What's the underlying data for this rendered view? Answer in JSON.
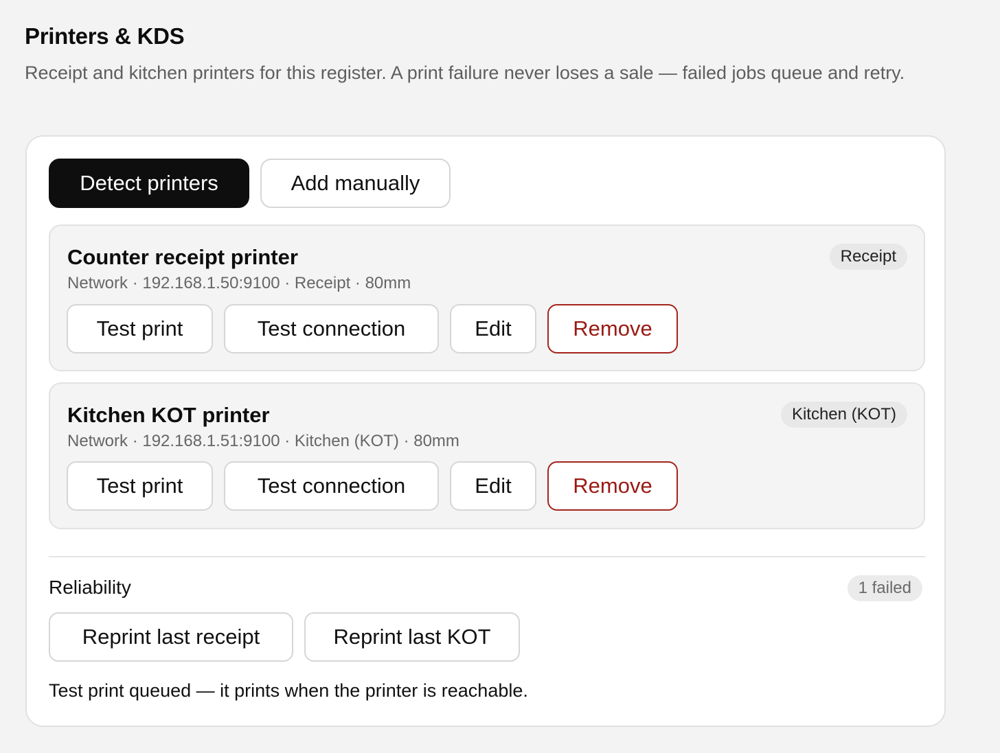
{
  "header": {
    "title": "Printers & KDS",
    "description": "Receipt and kitchen printers for this register. A print failure never loses a sale — failed jobs queue and retry."
  },
  "toolbar": {
    "detect_label": "Detect printers",
    "add_label": "Add manually"
  },
  "printers": [
    {
      "name": "Counter receipt printer",
      "meta": "Network · 192.168.1.50:9100 · Receipt · 80mm",
      "badge": "Receipt",
      "actions": {
        "test_print": "Test print",
        "test_connection": "Test connection",
        "edit": "Edit",
        "remove": "Remove"
      }
    },
    {
      "name": "Kitchen KOT printer",
      "meta": "Network · 192.168.1.51:9100 · Kitchen (KOT) · 80mm",
      "badge": "Kitchen (KOT)",
      "actions": {
        "test_print": "Test print",
        "test_connection": "Test connection",
        "edit": "Edit",
        "remove": "Remove"
      }
    }
  ],
  "reliability": {
    "title": "Reliability",
    "failed_badge": "1 failed",
    "reprint_receipt_label": "Reprint last receipt",
    "reprint_kot_label": "Reprint last KOT",
    "status_message": "Test print queued — it prints when the printer is reachable."
  },
  "colors": {
    "primary": "#0e0e0f",
    "danger": "#9a1a14",
    "page_bg": "#f3f3f3"
  }
}
